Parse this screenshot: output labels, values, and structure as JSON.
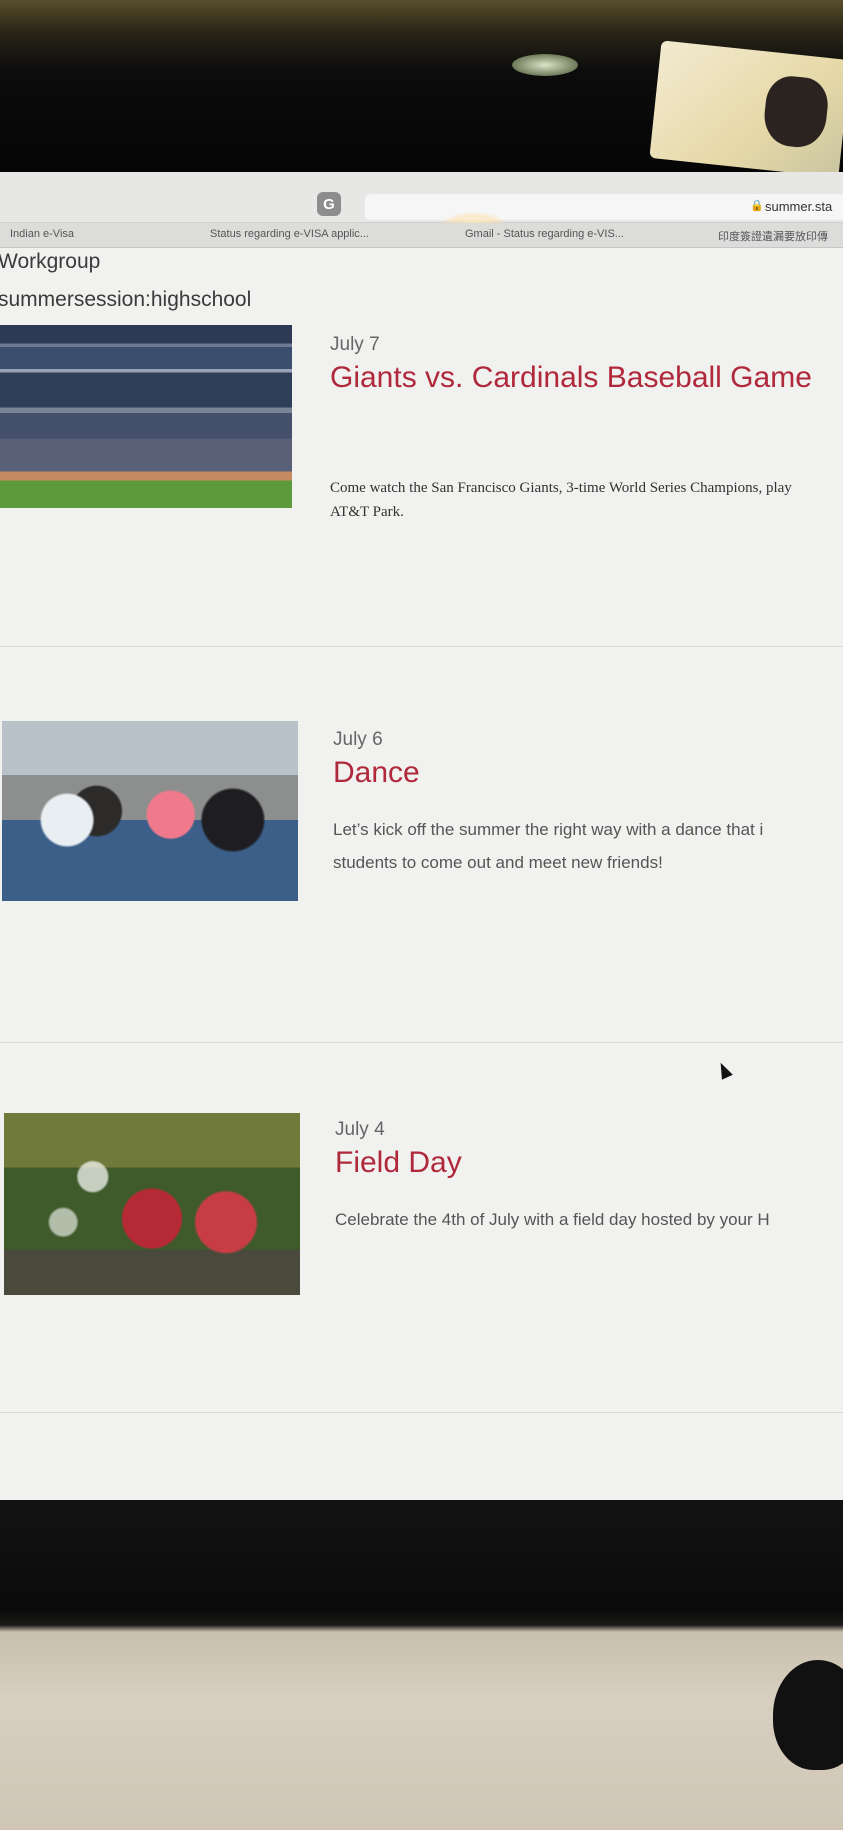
{
  "browser": {
    "url": "summer.sta",
    "bookmarks": [
      "Indian e-Visa",
      "Status regarding e-VISA applic...",
      "Gmail - Status regarding e-VIS...",
      "印度簽證遺漏要放印傳"
    ]
  },
  "breadcrumbs": [
    "Workgroup",
    "summersession:highschool"
  ],
  "events": [
    {
      "date": "July 7",
      "title": "Giants vs. Cardinals Baseball Game",
      "description_lines": [
        "Come watch the San Francisco Giants, 3-time World Series Champions, play",
        "AT&T Park."
      ]
    },
    {
      "date": "July 6",
      "title": "Dance",
      "description_lines": [
        "Let’s kick off the summer the right way with a dance that i",
        "students to come out and meet new friends!"
      ]
    },
    {
      "date": "July 4",
      "title": "Field Day",
      "description_lines": [
        "Celebrate the 4th of July with a field day hosted by your H"
      ]
    }
  ],
  "colors": {
    "title": "#b0283b",
    "date": "#666666"
  }
}
